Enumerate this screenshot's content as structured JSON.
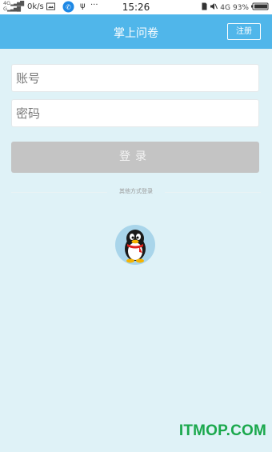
{
  "status_bar": {
    "network_top": "4G",
    "network_bottom": "G",
    "speed": "0k/s",
    "time": "15:26",
    "network_type": "4G",
    "battery_percent": "93%"
  },
  "header": {
    "title": "掌上问卷",
    "register_label": "注册",
    "background": "#50b6ea"
  },
  "login_form": {
    "account_placeholder": "账号",
    "password_placeholder": "密码",
    "login_label": "登录",
    "login_button_color": "#c4c4c4"
  },
  "other_login": {
    "label": "其他方式登录",
    "providers": [
      "qq-icon"
    ]
  },
  "watermark": "ITMOP.COM"
}
